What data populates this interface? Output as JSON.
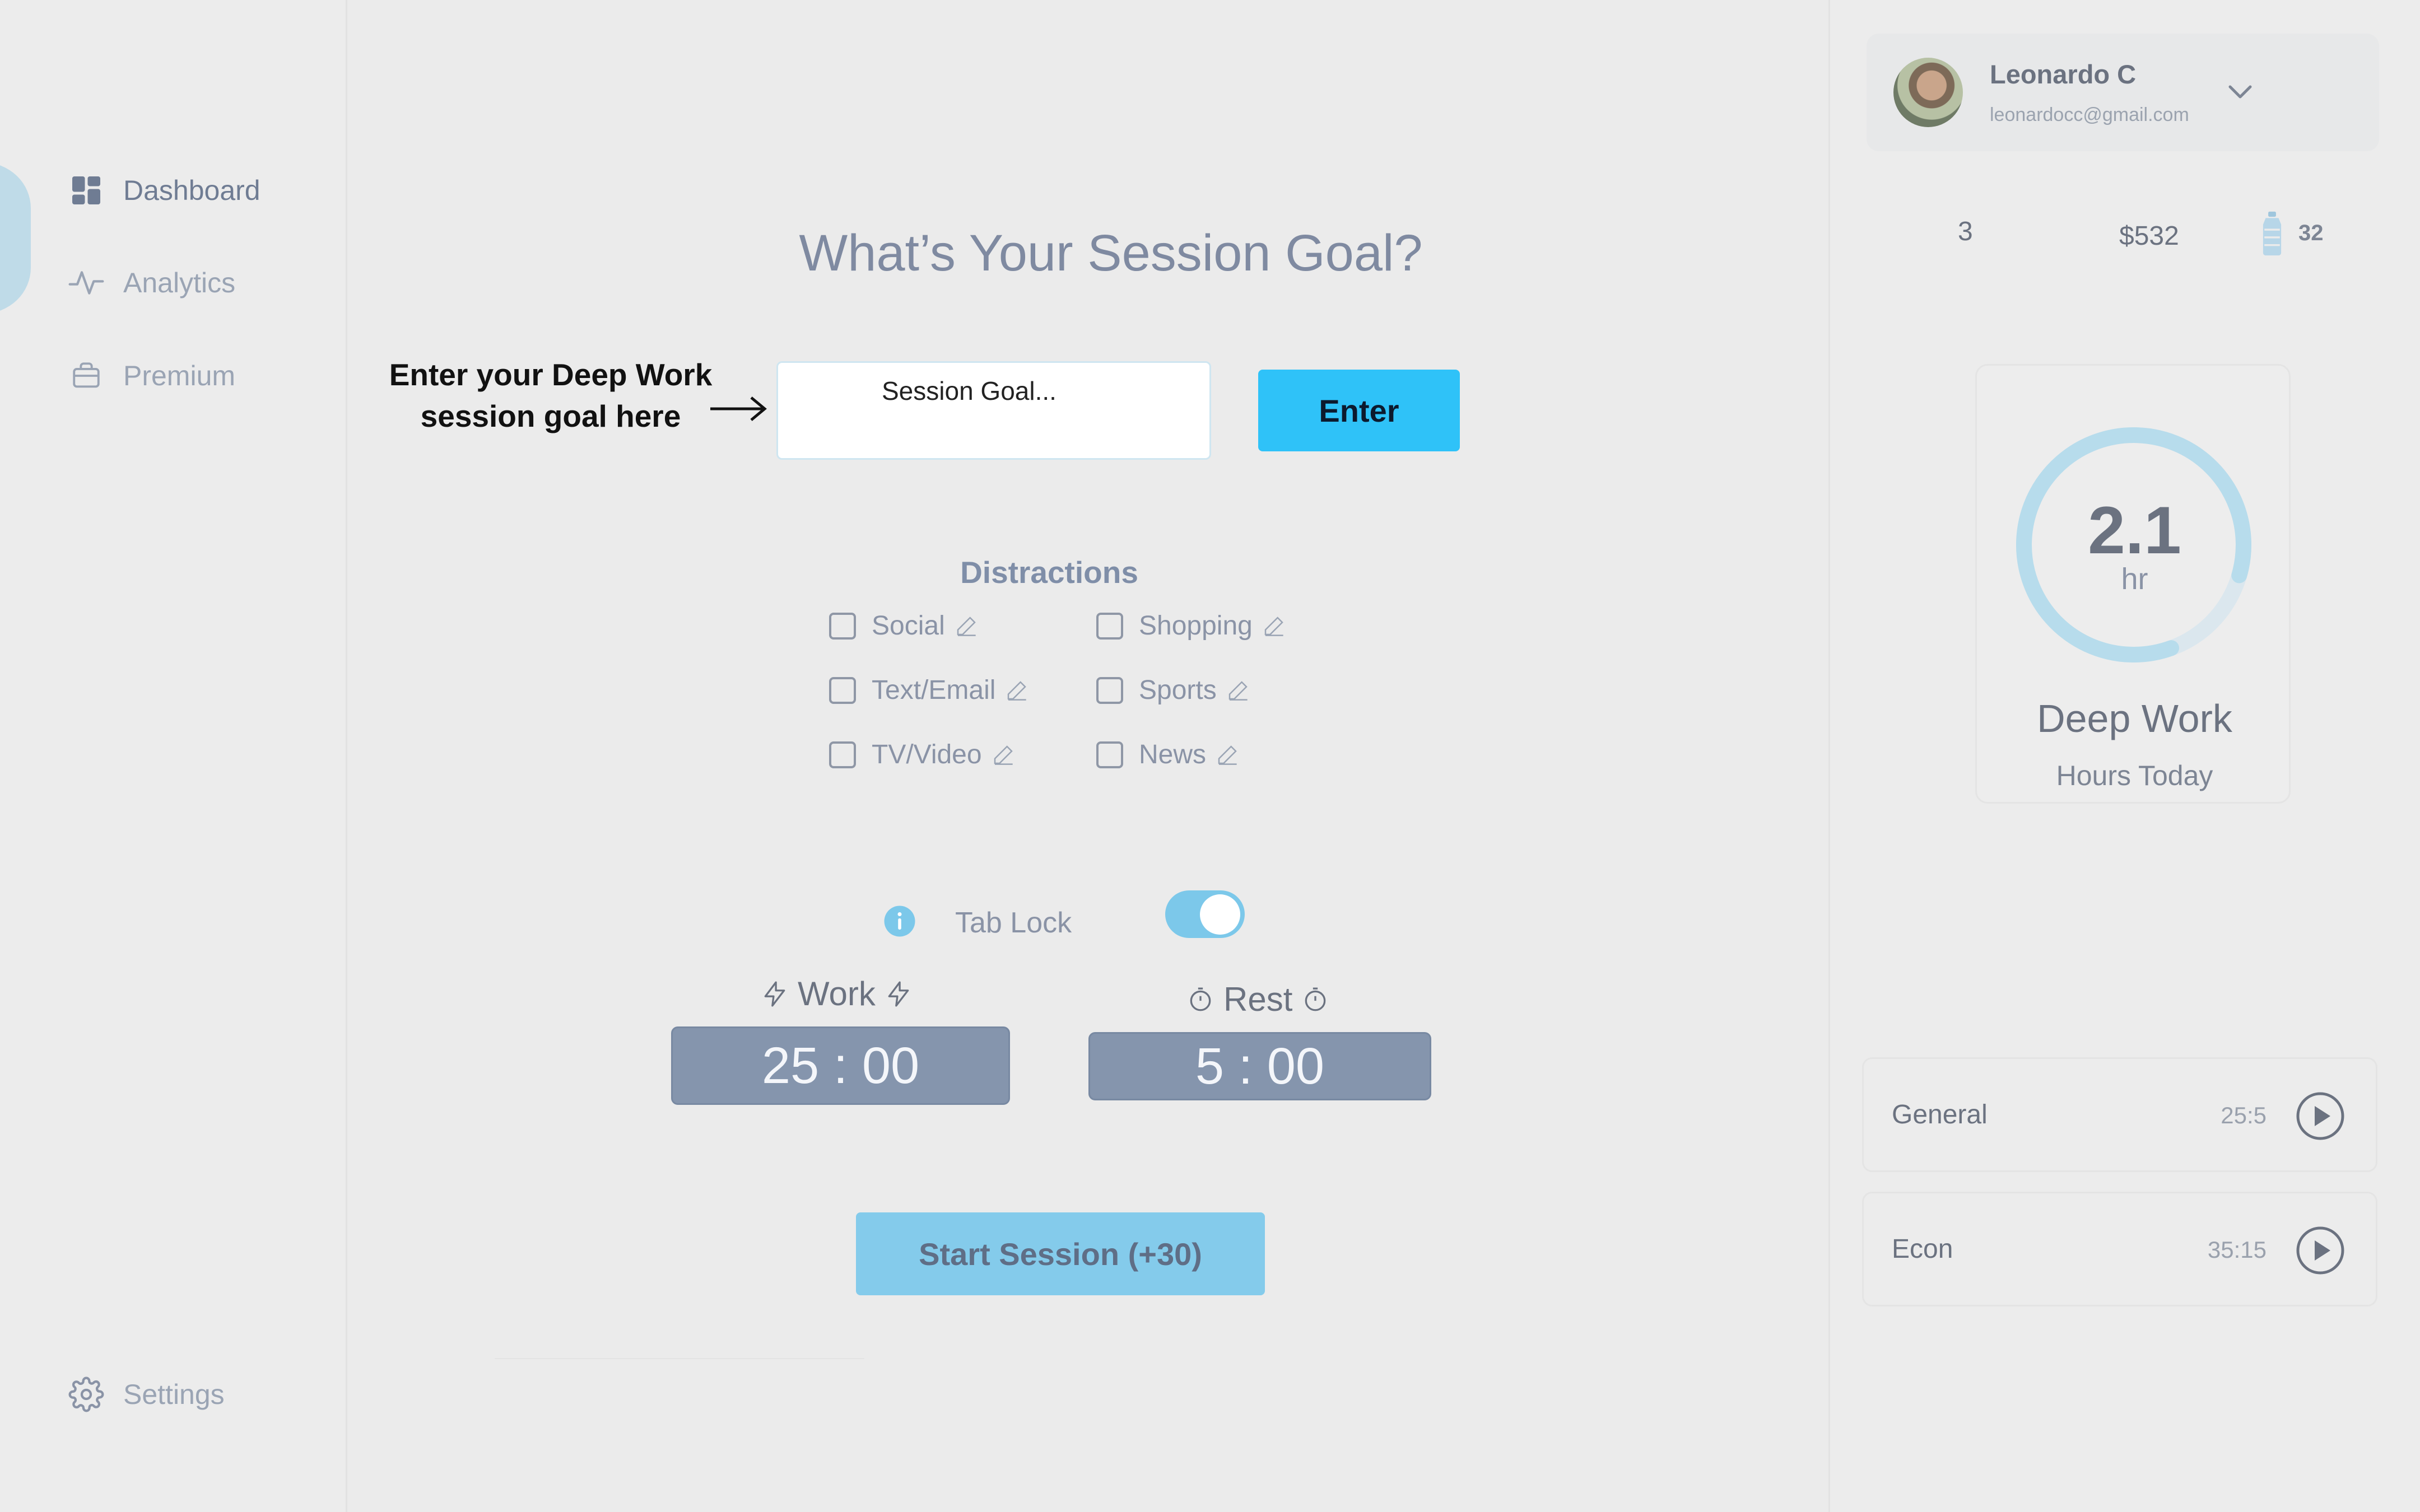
{
  "sidebar": {
    "items": [
      {
        "label": "Dashboard",
        "icon": "dashboard-grid-icon"
      },
      {
        "label": "Analytics",
        "icon": "activity-icon"
      },
      {
        "label": "Premium",
        "icon": "briefcase-icon"
      }
    ],
    "settings_label": "Settings"
  },
  "main": {
    "title": "What’s Your Session Goal?",
    "hint": "Enter your  Deep Work session goal here",
    "goal_placeholder": "Session Goal...",
    "goal_value": "",
    "enter_label": "Enter",
    "distractions": {
      "title": "Distractions",
      "items": [
        {
          "label": "Social",
          "checked": false
        },
        {
          "label": "Shopping",
          "checked": false
        },
        {
          "label": "Text/Email",
          "checked": false
        },
        {
          "label": "Sports",
          "checked": false
        },
        {
          "label": "TV/Video",
          "checked": false
        },
        {
          "label": "News",
          "checked": false
        }
      ]
    },
    "tab_lock": {
      "label": "Tab Lock",
      "enabled": true
    },
    "work": {
      "label": "Work",
      "time": "25 : 00"
    },
    "rest": {
      "label": "Rest",
      "time": "5 : 00"
    },
    "start_label": "Start Session (+30)"
  },
  "right": {
    "user": {
      "name": "Leonardo C",
      "email": "leonardocc@gmail.com"
    },
    "stats": {
      "streak": "3",
      "money": "$532",
      "water": "32"
    },
    "deep_work": {
      "value": "2.1",
      "unit": "hr",
      "title": "Deep Work",
      "subtitle": "Hours Today",
      "progress": 0.85
    },
    "sessions": [
      {
        "name": "General",
        "time": "25:5"
      },
      {
        "name": "Econ",
        "time": "35:15"
      }
    ]
  },
  "colors": {
    "accent": "#2fc2f8",
    "start_button": "#84cbeb",
    "timer_bg": "#8595ad",
    "ring": "#b7dcec"
  }
}
